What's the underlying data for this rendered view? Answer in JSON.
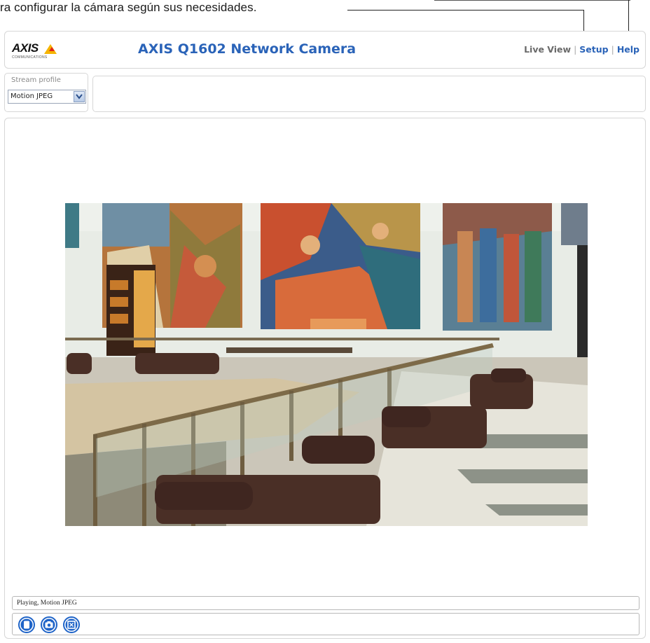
{
  "document": {
    "caption": "ra configurar la cámara según sus necesidades."
  },
  "header": {
    "logo_text": "AXIS",
    "logo_subtext": "COMMUNICATIONS",
    "title": "AXIS Q1602 Network Camera",
    "nav": {
      "live_view": "Live View",
      "setup": "Setup",
      "help": "Help",
      "separator": "|"
    }
  },
  "stream_profile": {
    "label": "Stream profile",
    "selected": "Motion JPEG"
  },
  "video": {
    "status": "Playing, Motion JPEG"
  },
  "controls": [
    {
      "name": "stop-icon"
    },
    {
      "name": "snapshot-icon"
    },
    {
      "name": "fullscreen-icon"
    }
  ],
  "colors": {
    "title_blue": "#2a63b8",
    "nav_gray": "#6a6a6a",
    "logo_yellow": "#f5b400",
    "control_blue": "#1f64c8"
  }
}
